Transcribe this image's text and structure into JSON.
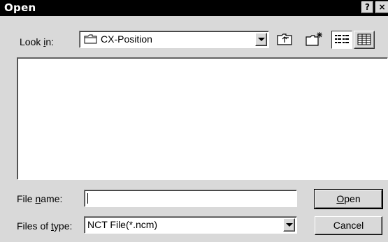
{
  "window": {
    "title": "Open",
    "help_glyph": "?",
    "close_glyph": "×"
  },
  "look_in": {
    "label_prefix": "Look ",
    "label_accel": "i",
    "label_suffix": "n:",
    "value": "CX-Position",
    "folder_icon": "folder-icon"
  },
  "toolbar": {
    "icons": [
      "up-one-level-icon",
      "create-new-folder-icon",
      "list-view-icon",
      "details-view-icon"
    ]
  },
  "file_name": {
    "label_prefix": "File ",
    "label_accel": "n",
    "label_suffix": "ame:",
    "value": ""
  },
  "files_of_type": {
    "label_prefix": "Files of ",
    "label_accel": "t",
    "label_suffix": "ype:",
    "value": "NCT File(*.ncm)"
  },
  "buttons": {
    "open_accel": "O",
    "open_rest": "pen",
    "cancel": "Cancel"
  }
}
